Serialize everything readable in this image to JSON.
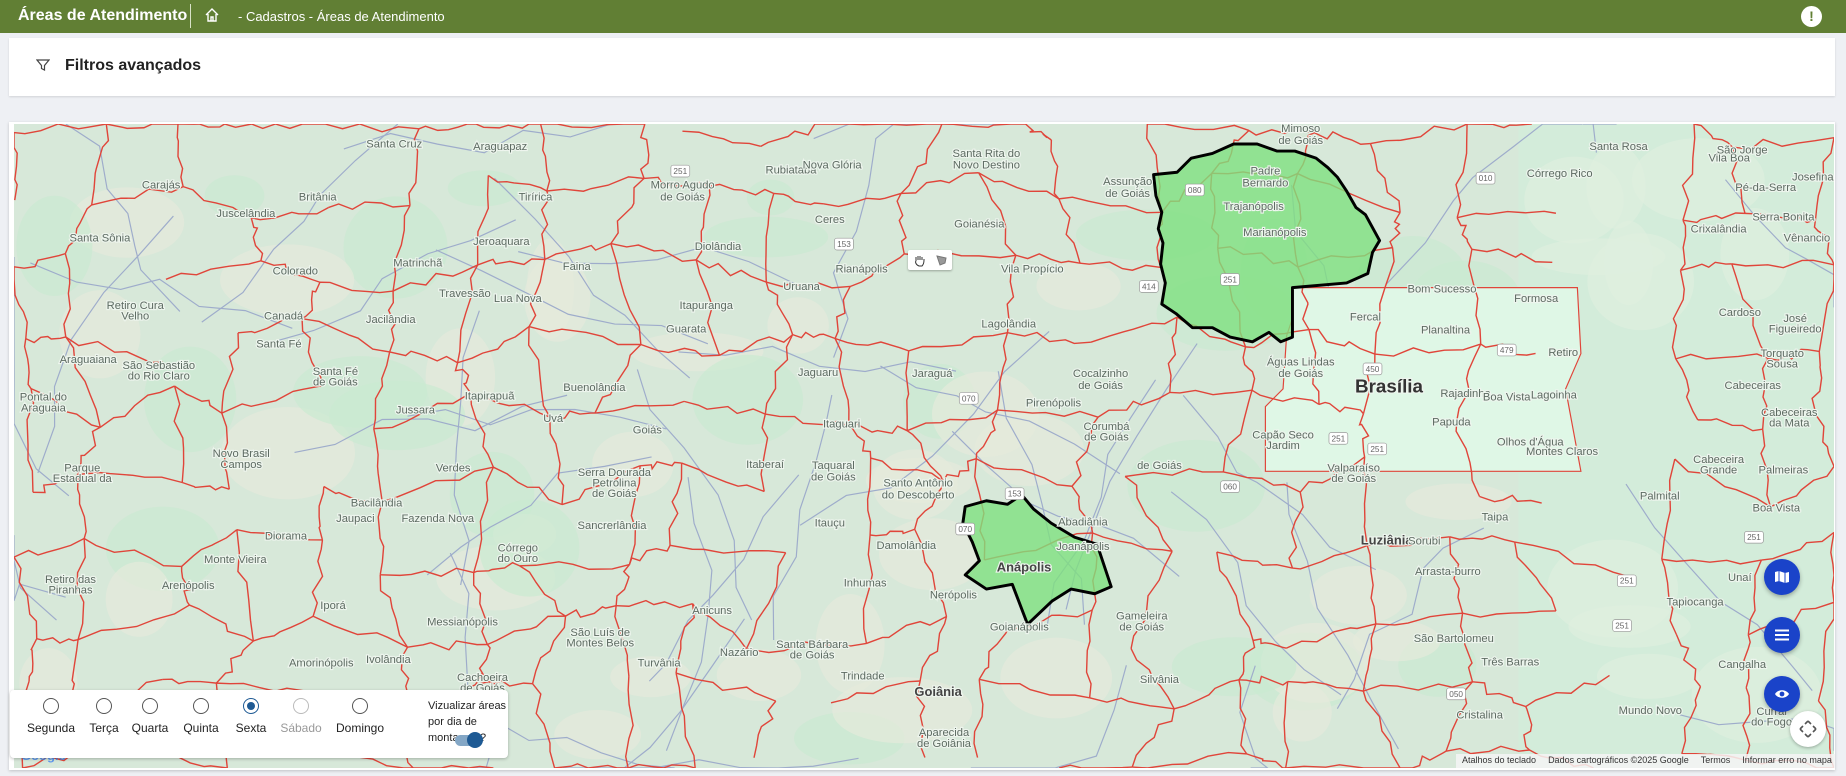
{
  "header": {
    "title": "Áreas de Atendimento",
    "breadcrumb": "- Cadastros - Áreas de Atendimento",
    "alert_icon": "!"
  },
  "filters": {
    "label": "Filtros avançados"
  },
  "map": {
    "labels": [
      "Santa Cruz",
      "Araguapaz",
      "Rubiataba",
      "Nova Glória",
      "Santa Rita do",
      "Novo Destino",
      "Mimoso",
      "de Goiás",
      "Vila Boa",
      "São Jorge",
      "Santa Rosa",
      "Carajás",
      "Britânia",
      "Juscelândia",
      "Morro Agudo",
      "de Goiás",
      "Ceres",
      "Goianésia",
      "Assunção",
      "de Goiás",
      "Padre",
      "Bernardo",
      "Trajanópolis",
      "Marianópolis",
      "Córrego Rico",
      "Pé-da-Serra",
      "Serra Bonita",
      "Josefina",
      "Santa Sônia",
      "Tirírica",
      "Diolândia",
      "Jeroaquara",
      "Matrinchã",
      "Faina",
      "Uruana",
      "Rianápolis",
      "Vila Propício",
      "Crixalândia",
      "Vênancio",
      "Colorado",
      "Travessão",
      "Lua Nova",
      "Itapuranga",
      "Bom Sucesso",
      "Fercal",
      "Planaltina",
      "Formosa",
      "Retiro Cura",
      "Velho",
      "Canadá",
      "Santa Fé",
      "Jacilândia",
      "Guarata",
      "Lagolândia",
      "Retiro",
      "Cardoso",
      "José",
      "Figueiredo",
      "Araguaiana",
      "São Sebastião",
      "do Rio Claro",
      "Santa Fé",
      "de Goiás",
      "Buenolândia",
      "Jaguaru",
      "Jaraguá",
      "Águas Lindas",
      "de Goiás",
      "Cocalzinho",
      "de Goiás",
      "Rajadinha",
      "Cabeceiras",
      "Torquato",
      "Sousa",
      "Pontal do",
      "Araguaia",
      "Jussara",
      "Itapirapuã",
      "Uvá",
      "Pirenópolis",
      "Corumbá",
      "de Goiás",
      "Papuda",
      "Boa Vista",
      "Lagoinha",
      "Cabeceiras",
      "da Mata",
      "Goiás",
      "Itaguari",
      "Itaberaí",
      "Taquaral",
      "de Goiás",
      "Santo Antônio",
      "do Descoberto",
      "Capão Seco",
      "Jardim",
      "Olhos d'Água",
      "Montes Claros",
      "de Goiás",
      "Novo Brasil",
      "Campos",
      "Verdes",
      "Parque",
      "Estadual da",
      "Serra Dourada",
      "Petrolina",
      "de Goiás",
      "Valparaíso",
      "de Goiás",
      "Cabeceira",
      "Grande",
      "Palmeiras",
      "Palmital",
      "Abadiânia",
      "Taipa",
      "Boa Vista",
      "Bacilândia",
      "Jaupaci",
      "Fazenda Nova",
      "Sancrerlândia",
      "Itauçu",
      "Luziânia",
      "Diorama",
      "Damolândia",
      "Joanápolis",
      "Anápolis",
      "Córrego",
      "do Ouro",
      "Monte Vieira",
      "Sorubi",
      "Arrasta-burro",
      "Unaí",
      "Retiro das",
      "Piranhas",
      "Arenópolis",
      "Inhumas",
      "Nerópolis",
      "Anicuns",
      "Gameleira",
      "de Goiás",
      "Tapiocanga",
      "Iporá",
      "Messianópolis",
      "São Luís de",
      "Montes Belos",
      "Goianápolis",
      "São Bartolomeu",
      "Três Barras",
      "Nazário",
      "Santa Bárbara",
      "de Goiás",
      "Cangalha",
      "Turvânia",
      "Trindade",
      "Goiânia",
      "Silvânia",
      "Amorinópolis",
      "Ivolândia",
      "Cachoeira",
      "de Goiás",
      "Aparecida",
      "de Goiânia",
      "Cristalina",
      "Mundo Novo",
      "Curral",
      "do Fogo",
      "Brasília"
    ],
    "shields": [
      "251",
      "153",
      "070",
      "080",
      "414",
      "251",
      "450",
      "479",
      "010",
      "251",
      "251",
      "060",
      "070",
      "153",
      "251",
      "050",
      "251",
      "251"
    ],
    "colors": {
      "background": "#d7e8d9",
      "border": "#e0453a",
      "road": "#9eaccb",
      "area_fill": "#7fe07f",
      "df_fill": "#dff7e6"
    }
  },
  "map_controls": {
    "pan_icon": "hand-icon",
    "draw_icon": "polygon-draw-icon",
    "layers_icon": "map-icon",
    "list_icon": "list-icon",
    "view_icon": "eye-icon",
    "fullscreen_icon": "move-arrows-icon"
  },
  "attribution": {
    "shortcuts": "Atalhos do teclado",
    "data": "Dados cartográficos ©2025 Google",
    "terms": "Termos",
    "report": "Informar erro no mapa",
    "logo": "Google"
  },
  "days_panel": {
    "days": [
      {
        "label": "Segunda",
        "checked": false,
        "disabled": false
      },
      {
        "label": "Terça",
        "checked": false,
        "disabled": false
      },
      {
        "label": "Quarta",
        "checked": false,
        "disabled": false
      },
      {
        "label": "Quinta",
        "checked": false,
        "disabled": false
      },
      {
        "label": "Sexta",
        "checked": true,
        "disabled": false
      },
      {
        "label": "Sábado",
        "checked": false,
        "disabled": true
      },
      {
        "label": "Domingo",
        "checked": false,
        "disabled": false
      }
    ],
    "toggle_label": "Vizualizar áreas por dia de montagem?",
    "toggle_on": true,
    "collapse_icon": "‹"
  }
}
